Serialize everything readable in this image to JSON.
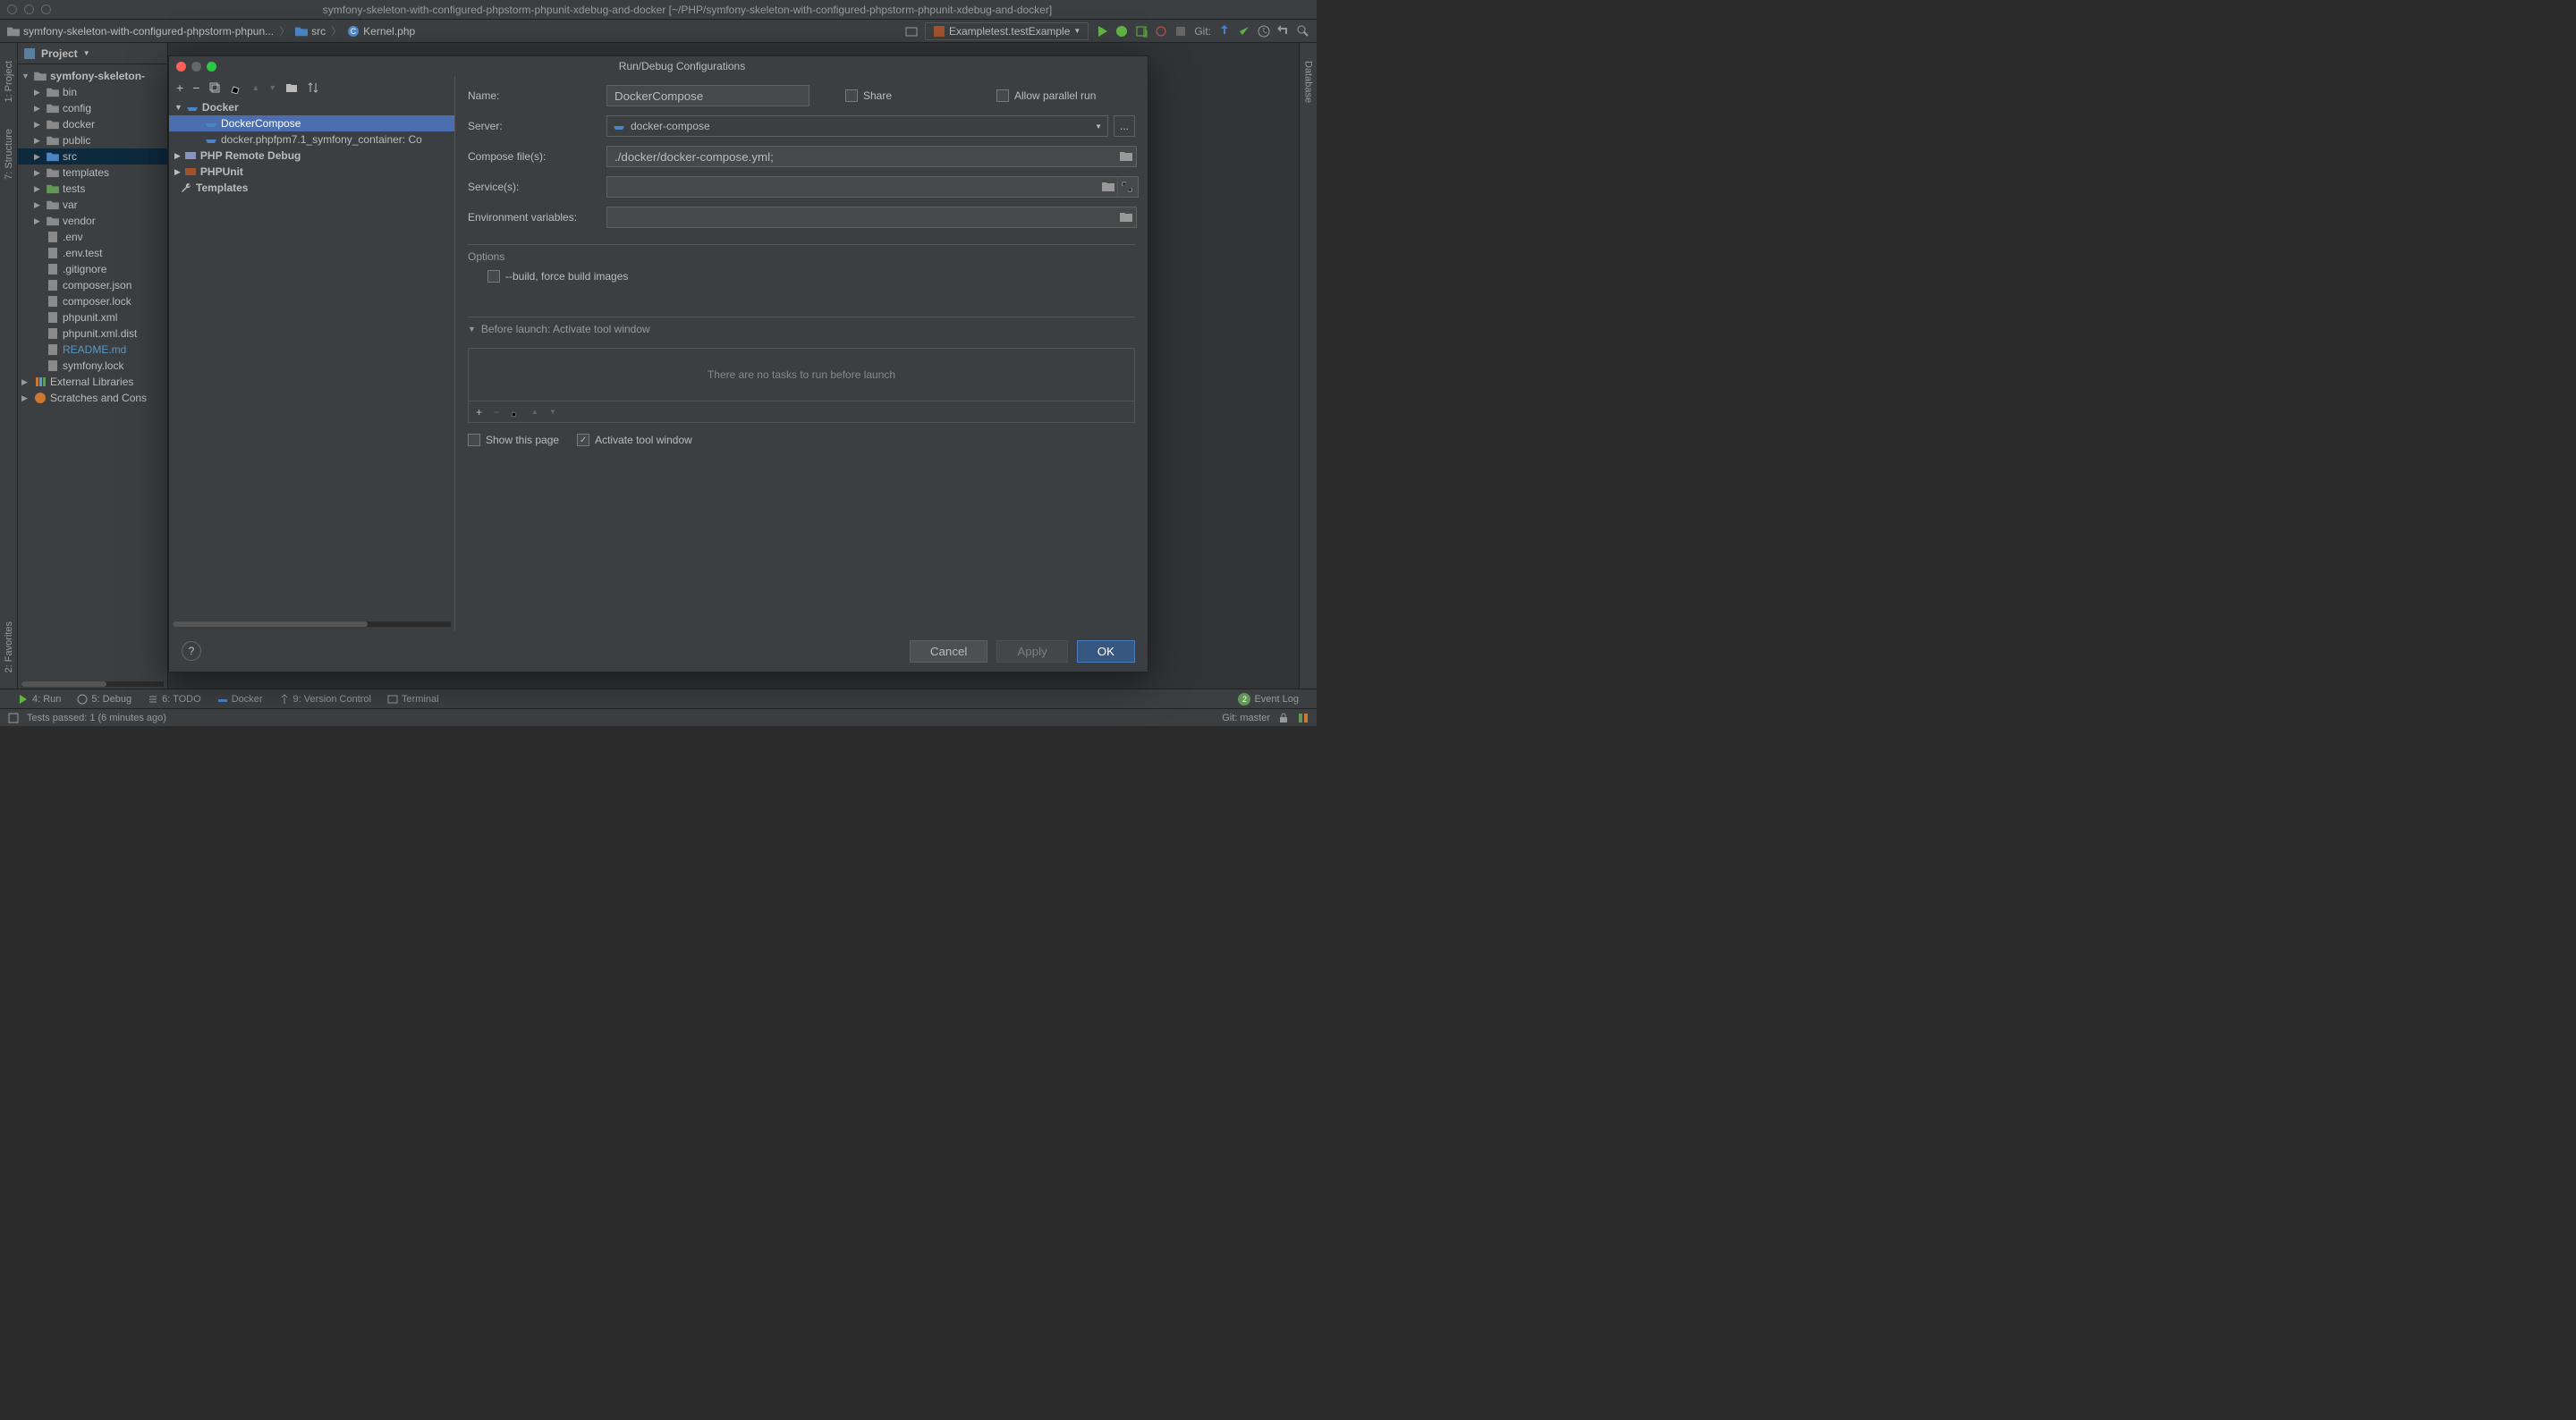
{
  "window_title": "symfony-skeleton-with-configured-phpstorm-phpunit-xdebug-and-docker [~/PHP/symfony-skeleton-with-configured-phpstorm-phpunit-xdebug-and-docker]",
  "breadcrumb": {
    "project": "symfony-skeleton-with-configured-phpstorm-phpun...",
    "folder": "src",
    "file": "Kernel.php"
  },
  "run_config_selector": "Exampletest.testExample",
  "git_label": "Git:",
  "git_branch_label": "Git: master",
  "project_label": "Project",
  "left_tabs": [
    "2: Favorites",
    "7: Structure",
    "1: Project"
  ],
  "right_tabs": [
    "Database"
  ],
  "tree": {
    "root": "symfony-skeleton-",
    "items": [
      {
        "label": "bin",
        "type": "folder-dark"
      },
      {
        "label": "config",
        "type": "folder-dark"
      },
      {
        "label": "docker",
        "type": "folder-dark"
      },
      {
        "label": "public",
        "type": "folder-dark"
      },
      {
        "label": "src",
        "type": "folder-blue",
        "sel": true
      },
      {
        "label": "templates",
        "type": "folder-dark"
      },
      {
        "label": "tests",
        "type": "folder-green"
      },
      {
        "label": "var",
        "type": "folder-dark"
      },
      {
        "label": "vendor",
        "type": "folder-dark"
      },
      {
        "label": ".env",
        "type": "file"
      },
      {
        "label": ".env.test",
        "type": "file"
      },
      {
        "label": ".gitignore",
        "type": "file"
      },
      {
        "label": "composer.json",
        "type": "file"
      },
      {
        "label": "composer.lock",
        "type": "file"
      },
      {
        "label": "phpunit.xml",
        "type": "file"
      },
      {
        "label": "phpunit.xml.dist",
        "type": "file"
      },
      {
        "label": "README.md",
        "type": "file",
        "color": "#5897c5"
      },
      {
        "label": "symfony.lock",
        "type": "file"
      }
    ],
    "extras": [
      "External Libraries",
      "Scratches and Cons"
    ]
  },
  "bottom_tools": [
    "4: Run",
    "5: Debug",
    "6: TODO",
    "Docker",
    "9: Version Control",
    "Terminal"
  ],
  "event_log": "Event Log",
  "event_badge": "2",
  "status_text": "Tests passed: 1 (6 minutes ago)",
  "dialog": {
    "title": "Run/Debug Configurations",
    "tree": {
      "docker": "Docker",
      "docker_compose": "DockerCompose",
      "docker_container": "docker.phpfpm7.1_symfony_container: Co",
      "php_remote": "PHP Remote Debug",
      "phpunit": "PHPUnit",
      "templates": "Templates"
    },
    "form": {
      "name_label": "Name:",
      "name_value": "DockerCompose",
      "share_label": "Share",
      "parallel_label": "Allow parallel run",
      "server_label": "Server:",
      "server_value": "docker-compose",
      "compose_label": "Compose file(s):",
      "compose_value": "./docker/docker-compose.yml;",
      "services_label": "Service(s):",
      "env_label": "Environment variables:",
      "options_label": "Options",
      "build_label": "--build, force build images",
      "before_launch_label": "Before launch: Activate tool window",
      "no_tasks": "There are no tasks to run before launch",
      "show_page": "Show this page",
      "activate_tool": "Activate tool window"
    },
    "buttons": {
      "cancel": "Cancel",
      "apply": "Apply",
      "ok": "OK"
    }
  }
}
